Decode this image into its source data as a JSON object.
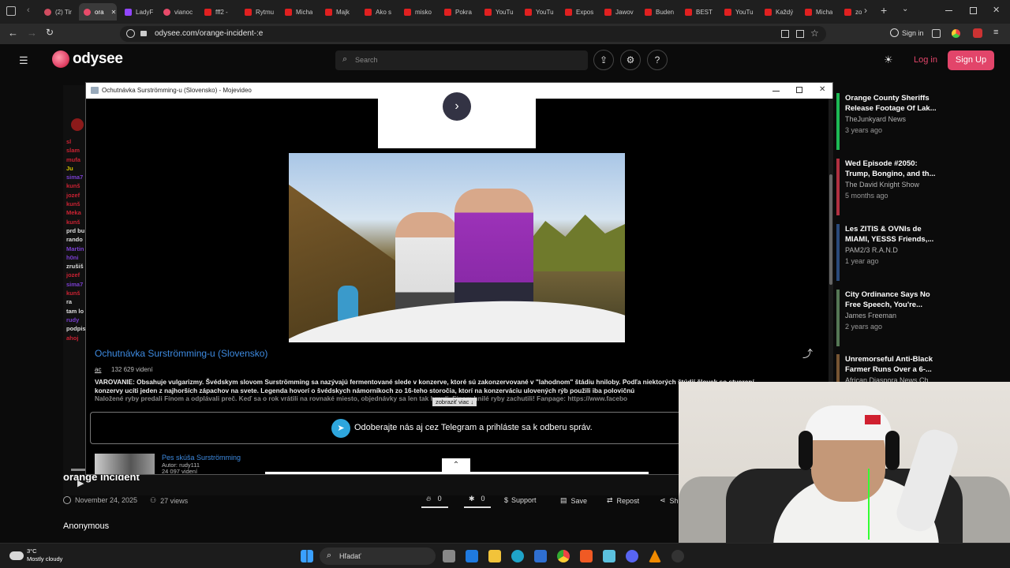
{
  "browser": {
    "tabs": [
      "(2) Tir",
      "ora",
      "LadyF",
      "vianoc",
      "fff2 - ",
      "Rytmu",
      "Micha",
      "Majk",
      "Ako s",
      "misko",
      "Pokra",
      "YouTu",
      "YouTu",
      "Expos",
      "Jawov",
      "Buden",
      "BEST",
      "YouTu",
      "Každý",
      "Micha",
      "zo"
    ],
    "url": "odysee.com/orange-incident-:e",
    "sign_in": "Sign in"
  },
  "site": {
    "logo": "odysee",
    "search_placeholder": "Search",
    "login": "Log in",
    "signup": "Sign Up",
    "video_title": "orange incident",
    "date": "November 24, 2025",
    "views": "27 views",
    "fire_count": "0",
    "slime_count": "0",
    "support": "Support",
    "save": "Save",
    "repost": "Repost",
    "share": "Sh",
    "channel": "Anonymous"
  },
  "chat": {
    "lines": [
      {
        "t": "sl",
        "c": "#c23"
      },
      {
        "t": "slam",
        "c": "#c23"
      },
      {
        "t": "mufa",
        "c": "#c23"
      },
      {
        "t": "Ju",
        "c": "#d4c500"
      },
      {
        "t": "",
        "c": "#c23"
      },
      {
        "t": "sima7",
        "c": "#7a3fd0"
      },
      {
        "t": "",
        "c": "#c23"
      },
      {
        "t": "kunš",
        "c": "#c23"
      },
      {
        "t": "jozef",
        "c": "#c23"
      },
      {
        "t": "kunš",
        "c": "#c23"
      },
      {
        "t": "Meka",
        "c": "#c23"
      },
      {
        "t": "",
        "c": "#c23"
      },
      {
        "t": "kunš",
        "c": "#c23"
      },
      {
        "t": "prd bu",
        "c": "#ddd"
      },
      {
        "t": "rando",
        "c": "#ddd"
      },
      {
        "t": "Martin",
        "c": "#7a3fd0"
      },
      {
        "t": "h0ni",
        "c": "#7a3fd0"
      },
      {
        "t": "zrušiš",
        "c": "#ddd"
      },
      {
        "t": "jozef",
        "c": "#c23"
      },
      {
        "t": "sima7",
        "c": "#7a3fd0"
      },
      {
        "t": "kunš",
        "c": "#c23"
      },
      {
        "t": "ra",
        "c": "#ddd"
      },
      {
        "t": "tam lo",
        "c": "#ddd"
      },
      {
        "t": "rudy",
        "c": "#7a3fd0"
      },
      {
        "t": "podpis",
        "c": "#ddd"
      },
      {
        "t": "ahoj",
        "c": "#c23"
      }
    ]
  },
  "popup": {
    "window_title": "Ochutnávka Surströmming-u (Slovensko) - Mojevideo",
    "title": "Ochutnávka Surströmming-u (Slovensko)",
    "uploader": "ac",
    "views": "132 629 videní",
    "desc1": "VAROVANIE: Obsahuje vulgarizmy. Švédskym slovom Surströmming sa nazývajú fermentované slede v konzerve, ktoré sú zakonzervované v \"lahodnom\" štádiu hniloby. Podľa niektorých štúdií človek so stvorení",
    "desc2": "konzervy ucíti jeden z najhorších zápachov na svete. Legenda hovorí o švédskych námorníkoch zo 16-teho storočia, ktorí na konzerváciu ulovených rýb použili iba polovičnú",
    "desc3": "Naložené ryby predali Fínom a odplávali preč. Keď sa o rok vrátili na rovnaké miesto, objednávky sa len tak hrnuli. Fínom hnilé ryby zachutili! Fanpage: https://www.facebo",
    "show_more": "zobraziť viac ↓",
    "telegram": "Odoberajte nás aj cez Telegram a prihláste sa k odberu správ.",
    "related_title": "Pes skúša Surströmming",
    "related_author": "Autor: rudy111",
    "related_views": "24 097 videní"
  },
  "recommendations": [
    {
      "title": "Orange County Sheriffs Release Footage Of Lak...",
      "channel": "TheJunkyard News",
      "age": "3 years ago",
      "color": "#1db954"
    },
    {
      "title": "Wed Episode #2050: Trump, Bongino, and th...",
      "channel": "The David Knight Show",
      "age": "5 months ago",
      "color": "#b03040"
    },
    {
      "title": "Les ZITIS & OVNIs de MIAMI, YESSS Friends,...",
      "channel": "PAM2/3 R.A.N.D",
      "age": "1 year ago",
      "color": "#2a4a7a"
    },
    {
      "title": "City Ordinance Says No Free Speech, You're...",
      "channel": "James Freeman",
      "age": "2 years ago",
      "color": "#557755"
    },
    {
      "title": "Unremorseful Anti-Black Farmer Runs Over a 6-...",
      "channel": "African Diaspora News Ch...",
      "age": "",
      "color": "#775533"
    }
  ],
  "taskbar": {
    "temp": "3°C",
    "weather": "Mostly cloudy",
    "search": "Hľadať"
  }
}
